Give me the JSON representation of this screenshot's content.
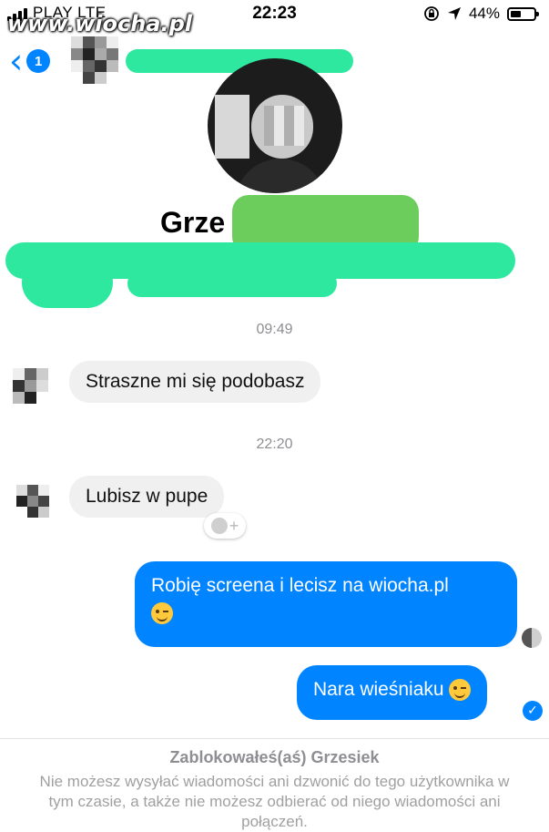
{
  "status_bar": {
    "carrier": "PLAY   LTE",
    "time": "22:23",
    "battery": "44%",
    "battery_level": 0.44,
    "watermark": "www.wiocha.pl",
    "icons": [
      "signal-icon",
      "rotation-lock-icon",
      "location-arrow-icon",
      "battery-icon"
    ]
  },
  "nav": {
    "back_badge": "1",
    "icons": [
      "back-chevron-icon"
    ]
  },
  "profile": {
    "name": "Grze"
  },
  "messages": [
    {
      "type": "timestamp",
      "text": "09:49"
    },
    {
      "type": "incoming",
      "text": "Straszne mi się podobasz"
    },
    {
      "type": "timestamp",
      "text": "22:20"
    },
    {
      "type": "incoming",
      "text": "Lubisz w pupe"
    },
    {
      "type": "outgoing",
      "text": "Robię screena i lecisz na wiocha.pl",
      "emoji": "winking-face-emoji"
    },
    {
      "type": "outgoing",
      "text": "Nara wieśniaku",
      "emoji": "winking-face-emoji"
    }
  ],
  "reaction_button": {
    "label": "+"
  },
  "blocked_notice": {
    "title": "Zablokowałeś(aś) Grzesiek",
    "text": "Nie możesz wysyłać wiadomości ani dzwonić do tego użytkownika w tym czasie, a także nie możesz odbierać od niego wiadomości ani połączeń."
  },
  "colors": {
    "accent": "#0084ff",
    "incoming_bubble": "#f0f0f0",
    "redaction": "#2ee8a0"
  }
}
